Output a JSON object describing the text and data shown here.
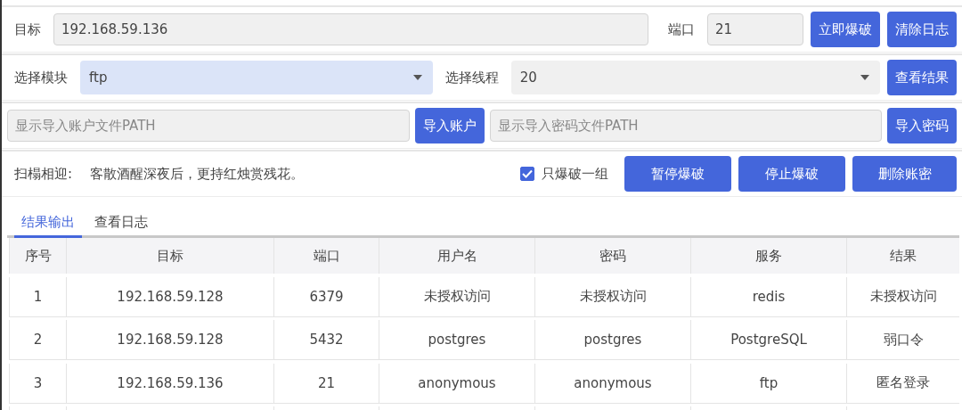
{
  "target": {
    "label": "目标",
    "value": "192.168.59.136"
  },
  "port": {
    "label": "端口",
    "value": "21"
  },
  "top_buttons": [
    "立即爆破",
    "清除日志"
  ],
  "module": {
    "label": "选择模块",
    "value": "ftp",
    "focused": true
  },
  "threads": {
    "label": "选择线程",
    "value": "20",
    "focused": false
  },
  "view_results_button": "查看结果",
  "account_file": {
    "placeholder": "显示导入账户文件PATH",
    "button": "导入账户"
  },
  "password_file": {
    "placeholder": "显示导入密码文件PATH",
    "button": "导入密码"
  },
  "greeting": {
    "label": "扫榻相迎:",
    "text": "客散酒醒深夜后，更持红烛赏残花。"
  },
  "only_one_group": {
    "label": "只爆破一组",
    "checked": true
  },
  "action_buttons": [
    "暂停爆破",
    "停止爆破",
    "删除账密"
  ],
  "tabs": [
    {
      "label": "结果输出",
      "selected": true
    },
    {
      "label": "查看日志",
      "selected": false
    }
  ],
  "table": {
    "columns": [
      "序号",
      "目标",
      "端口",
      "用户名",
      "密码",
      "服务",
      "结果"
    ],
    "rows": [
      [
        "1",
        "192.168.59.128",
        "6379",
        "未授权访问",
        "未授权访问",
        "redis",
        "未授权访问"
      ],
      [
        "2",
        "192.168.59.128",
        "5432",
        "postgres",
        "postgres",
        "PostgreSQL",
        "弱口令"
      ],
      [
        "3",
        "192.168.59.136",
        "21",
        "anonymous",
        "anonymous",
        "ftp",
        "匿名登录"
      ]
    ]
  }
}
